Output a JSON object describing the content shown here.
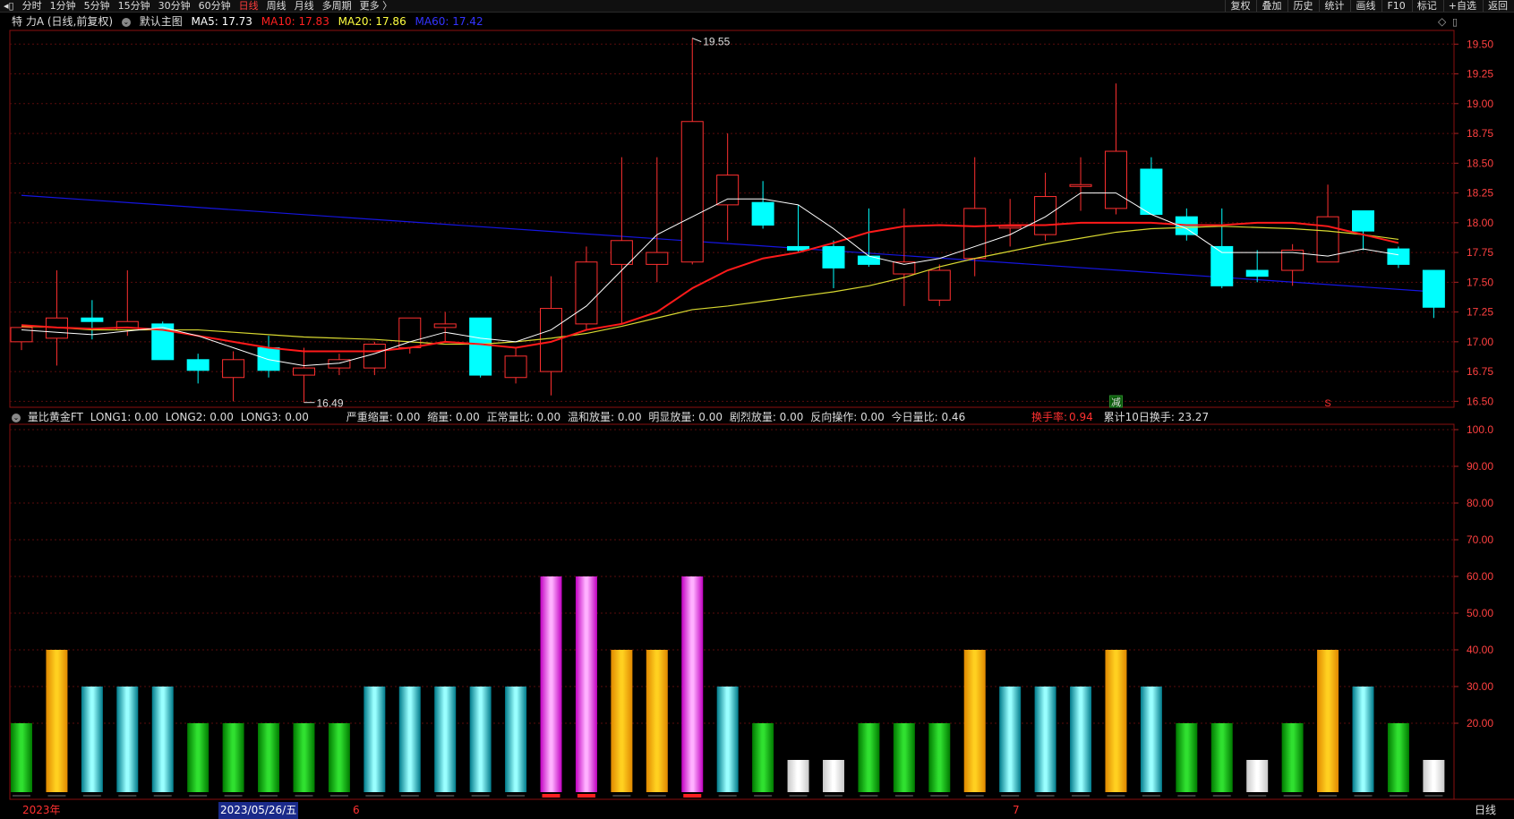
{
  "toolbar": {
    "left_icon": "panel-toggle-icon",
    "periods": [
      "分时",
      "1分钟",
      "5分钟",
      "15分钟",
      "30分钟",
      "60分钟",
      "日线",
      "周线",
      "月线",
      "多周期",
      "更多 〉"
    ],
    "active_period": "日线",
    "right_buttons": [
      "复权",
      "叠加",
      "历史",
      "统计",
      "画线",
      "F10",
      "标记",
      "+自选",
      "返回"
    ]
  },
  "main_info": {
    "title": "特 力A (日线,前复权)",
    "theme": "默认主图",
    "ma5": "MA5: 17.73",
    "ma10": "MA10: 17.83",
    "ma20": "MA20: 17.86",
    "ma60": "MA60: 17.42",
    "colors": {
      "ma5": "#ffffff",
      "ma10": "#ff2020",
      "ma20": "#dddd30",
      "ma60": "#2222ff"
    }
  },
  "sub_info": {
    "title": "量比黄金FT",
    "long1": "LONG1: 0.00",
    "long2": "LONG2: 0.00",
    "long3": "LONG3: 0.00",
    "v1": "严重缩量: 0.00",
    "v2": "缩量: 0.00",
    "v3": "正常量比: 0.00",
    "v4": "温和放量: 0.00",
    "v5": "明显放量: 0.00",
    "v6": "剧烈放量: 0.00",
    "v7": "反向操作: 0.00",
    "v8": "今日量比: 0.46",
    "turnover_label": "换手率:",
    "turnover_value": "0.94",
    "turnover10": "累计10日换手: 23.27"
  },
  "price_axis": [
    "19.50",
    "19.25",
    "19.00",
    "18.75",
    "18.50",
    "18.25",
    "18.00",
    "17.75",
    "17.50",
    "17.25",
    "17.00",
    "16.75",
    "16.50"
  ],
  "sub_axis": [
    "100.0",
    "90.00",
    "80.00",
    "70.00",
    "60.00",
    "50.00",
    "40.00",
    "30.00",
    "20.00"
  ],
  "annotations": {
    "high": "19.55",
    "low": "16.49",
    "mark_jian": "减",
    "mark_s": "S"
  },
  "bottom": {
    "year": "2023年",
    "date": "2023/05/26/五",
    "m6": "6",
    "m7": "7",
    "period": "日线"
  },
  "chart_data": {
    "type": "candlestick",
    "candles": [
      {
        "o": 17.0,
        "h": 17.1,
        "l": 16.93,
        "c": 17.12
      },
      {
        "o": 17.03,
        "h": 17.6,
        "l": 16.8,
        "c": 17.2
      },
      {
        "o": 17.2,
        "h": 17.35,
        "l": 17.02,
        "c": 17.17
      },
      {
        "o": 17.1,
        "h": 17.6,
        "l": 17.05,
        "c": 17.17
      },
      {
        "o": 17.15,
        "h": 17.17,
        "l": 16.88,
        "c": 16.85
      },
      {
        "o": 16.85,
        "h": 16.9,
        "l": 16.65,
        "c": 16.76
      },
      {
        "o": 16.7,
        "h": 16.92,
        "l": 16.5,
        "c": 16.85
      },
      {
        "o": 16.95,
        "h": 17.05,
        "l": 16.7,
        "c": 16.76
      },
      {
        "o": 16.72,
        "h": 16.95,
        "l": 16.49,
        "c": 16.78
      },
      {
        "o": 16.78,
        "h": 16.9,
        "l": 16.72,
        "c": 16.85
      },
      {
        "o": 16.78,
        "h": 17.0,
        "l": 16.72,
        "c": 16.98
      },
      {
        "o": 16.95,
        "h": 17.2,
        "l": 16.9,
        "c": 17.2
      },
      {
        "o": 17.12,
        "h": 17.25,
        "l": 17.0,
        "c": 17.15
      },
      {
        "o": 17.2,
        "h": 17.2,
        "l": 16.7,
        "c": 16.72
      },
      {
        "o": 16.7,
        "h": 16.95,
        "l": 16.65,
        "c": 16.88
      },
      {
        "o": 16.75,
        "h": 17.55,
        "l": 16.55,
        "c": 17.28
      },
      {
        "o": 17.15,
        "h": 17.8,
        "l": 17.1,
        "c": 17.67
      },
      {
        "o": 17.65,
        "h": 18.55,
        "l": 17.15,
        "c": 17.85
      },
      {
        "o": 17.65,
        "h": 18.55,
        "l": 17.5,
        "c": 17.75
      },
      {
        "o": 17.67,
        "h": 19.55,
        "l": 17.65,
        "c": 18.85
      },
      {
        "o": 18.15,
        "h": 18.75,
        "l": 17.85,
        "c": 18.4
      },
      {
        "o": 18.17,
        "h": 18.35,
        "l": 17.95,
        "c": 17.98
      },
      {
        "o": 17.8,
        "h": 18.15,
        "l": 17.75,
        "c": 17.77
      },
      {
        "o": 17.8,
        "h": 17.85,
        "l": 17.45,
        "c": 17.62
      },
      {
        "o": 17.72,
        "h": 18.12,
        "l": 17.63,
        "c": 17.65
      },
      {
        "o": 17.57,
        "h": 18.12,
        "l": 17.3,
        "c": 17.67
      },
      {
        "o": 17.35,
        "h": 17.65,
        "l": 17.3,
        "c": 17.6
      },
      {
        "o": 17.7,
        "h": 18.55,
        "l": 17.55,
        "c": 18.12
      },
      {
        "o": 17.97,
        "h": 18.2,
        "l": 17.8,
        "c": 17.97
      },
      {
        "o": 17.9,
        "h": 18.42,
        "l": 17.85,
        "c": 18.22
      },
      {
        "o": 18.32,
        "h": 18.55,
        "l": 18.1,
        "c": 18.32
      },
      {
        "o": 18.12,
        "h": 19.17,
        "l": 18.07,
        "c": 18.6
      },
      {
        "o": 18.45,
        "h": 18.55,
        "l": 18.07,
        "c": 18.07
      },
      {
        "o": 18.05,
        "h": 18.12,
        "l": 17.85,
        "c": 17.9
      },
      {
        "o": 17.8,
        "h": 18.12,
        "l": 17.45,
        "c": 17.47
      },
      {
        "o": 17.6,
        "h": 17.77,
        "l": 17.5,
        "c": 17.55
      },
      {
        "o": 17.6,
        "h": 17.82,
        "l": 17.47,
        "c": 17.77
      },
      {
        "o": 17.67,
        "h": 18.32,
        "l": 17.67,
        "c": 18.05
      },
      {
        "o": 18.1,
        "h": 18.1,
        "l": 17.77,
        "c": 17.93
      },
      {
        "o": 17.78,
        "h": 17.8,
        "l": 17.62,
        "c": 17.65
      },
      {
        "o": 17.6,
        "h": 17.6,
        "l": 17.2,
        "c": 17.29
      }
    ],
    "ma5": [
      17.1,
      17.08,
      17.06,
      17.09,
      17.12,
      17.05,
      16.95,
      16.85,
      16.8,
      16.82,
      16.9,
      17.0,
      17.08,
      17.03,
      17.0,
      17.1,
      17.3,
      17.6,
      17.9,
      18.05,
      18.2,
      18.2,
      18.15,
      17.95,
      17.72,
      17.65,
      17.7,
      17.8,
      17.9,
      18.05,
      18.25,
      18.25,
      18.07,
      17.95,
      17.75,
      17.75,
      17.75,
      17.72,
      17.78,
      17.73
    ],
    "ma10": [
      17.14,
      17.12,
      17.11,
      17.12,
      17.1,
      17.05,
      17.0,
      16.95,
      16.92,
      16.92,
      16.92,
      16.95,
      17.0,
      16.98,
      16.95,
      17.0,
      17.1,
      17.15,
      17.25,
      17.45,
      17.6,
      17.7,
      17.75,
      17.83,
      17.92,
      17.97,
      17.98,
      17.97,
      17.98,
      17.98,
      18.0,
      18.0,
      18.0,
      17.98,
      17.98,
      18.0,
      18.0,
      17.97,
      17.9,
      17.83
    ],
    "ma20": [
      17.13,
      17.12,
      17.1,
      17.1,
      17.1,
      17.1,
      17.08,
      17.06,
      17.04,
      17.03,
      17.02,
      17.0,
      16.98,
      16.98,
      17.0,
      17.03,
      17.07,
      17.13,
      17.2,
      17.27,
      17.3,
      17.34,
      17.38,
      17.42,
      17.47,
      17.54,
      17.63,
      17.7,
      17.76,
      17.82,
      17.87,
      17.92,
      17.95,
      17.96,
      17.97,
      17.96,
      17.95,
      17.93,
      17.9,
      17.86
    ],
    "ma60_start": 18.23,
    "ma60_end": 17.42,
    "volume_ratio_bars": [
      20,
      40,
      30,
      30,
      30,
      20,
      20,
      20,
      20,
      20,
      30,
      30,
      30,
      30,
      30,
      60,
      60,
      40,
      40,
      60,
      30,
      20,
      10,
      10,
      20,
      20,
      20,
      40,
      30,
      30,
      30,
      40,
      30,
      20,
      20,
      10,
      20,
      40,
      30,
      20,
      10
    ],
    "ylim_price": [
      16.45,
      19.6
    ],
    "ylim_sub": [
      0,
      100
    ]
  }
}
